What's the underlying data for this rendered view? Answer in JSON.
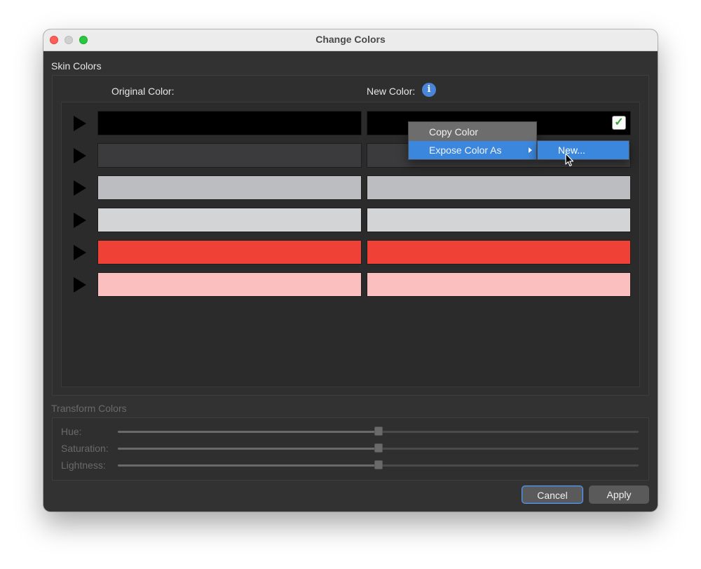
{
  "window": {
    "title": "Change Colors"
  },
  "skin_colors": {
    "label": "Skin Colors",
    "original_header": "Original Color:",
    "new_header": "New Color:",
    "rows": [
      {
        "original": "#000000",
        "new": "#000000",
        "checked": true
      },
      {
        "original": "#3b3b3d",
        "new": "#3b3b3d",
        "checked": false
      },
      {
        "original": "#bcbdc0",
        "new": "#bcbdc0",
        "checked": false
      },
      {
        "original": "#d3d4d6",
        "new": "#d3d4d6",
        "checked": false
      },
      {
        "original": "#ef4135",
        "new": "#ef4135",
        "checked": false
      },
      {
        "original": "#fcbfc0",
        "new": "#fcbfc0",
        "checked": false
      }
    ]
  },
  "transform_colors": {
    "label": "Transform Colors",
    "sliders": [
      {
        "label": "Hue:",
        "value": 0.5
      },
      {
        "label": "Saturation:",
        "value": 0.5
      },
      {
        "label": "Lightness:",
        "value": 0.5
      }
    ]
  },
  "buttons": {
    "cancel": "Cancel",
    "apply": "Apply"
  },
  "context_menu": {
    "items": [
      {
        "label": "Copy Color",
        "has_submenu": false
      },
      {
        "label": "Expose Color As",
        "has_submenu": true,
        "highlighted": true
      }
    ],
    "submenu": [
      {
        "label": "New..."
      }
    ]
  },
  "icons": {
    "info": "info-icon",
    "expand": "disclosure-triangle-icon",
    "check": "checkmark-icon",
    "cursor": "mouse-pointer-icon"
  }
}
